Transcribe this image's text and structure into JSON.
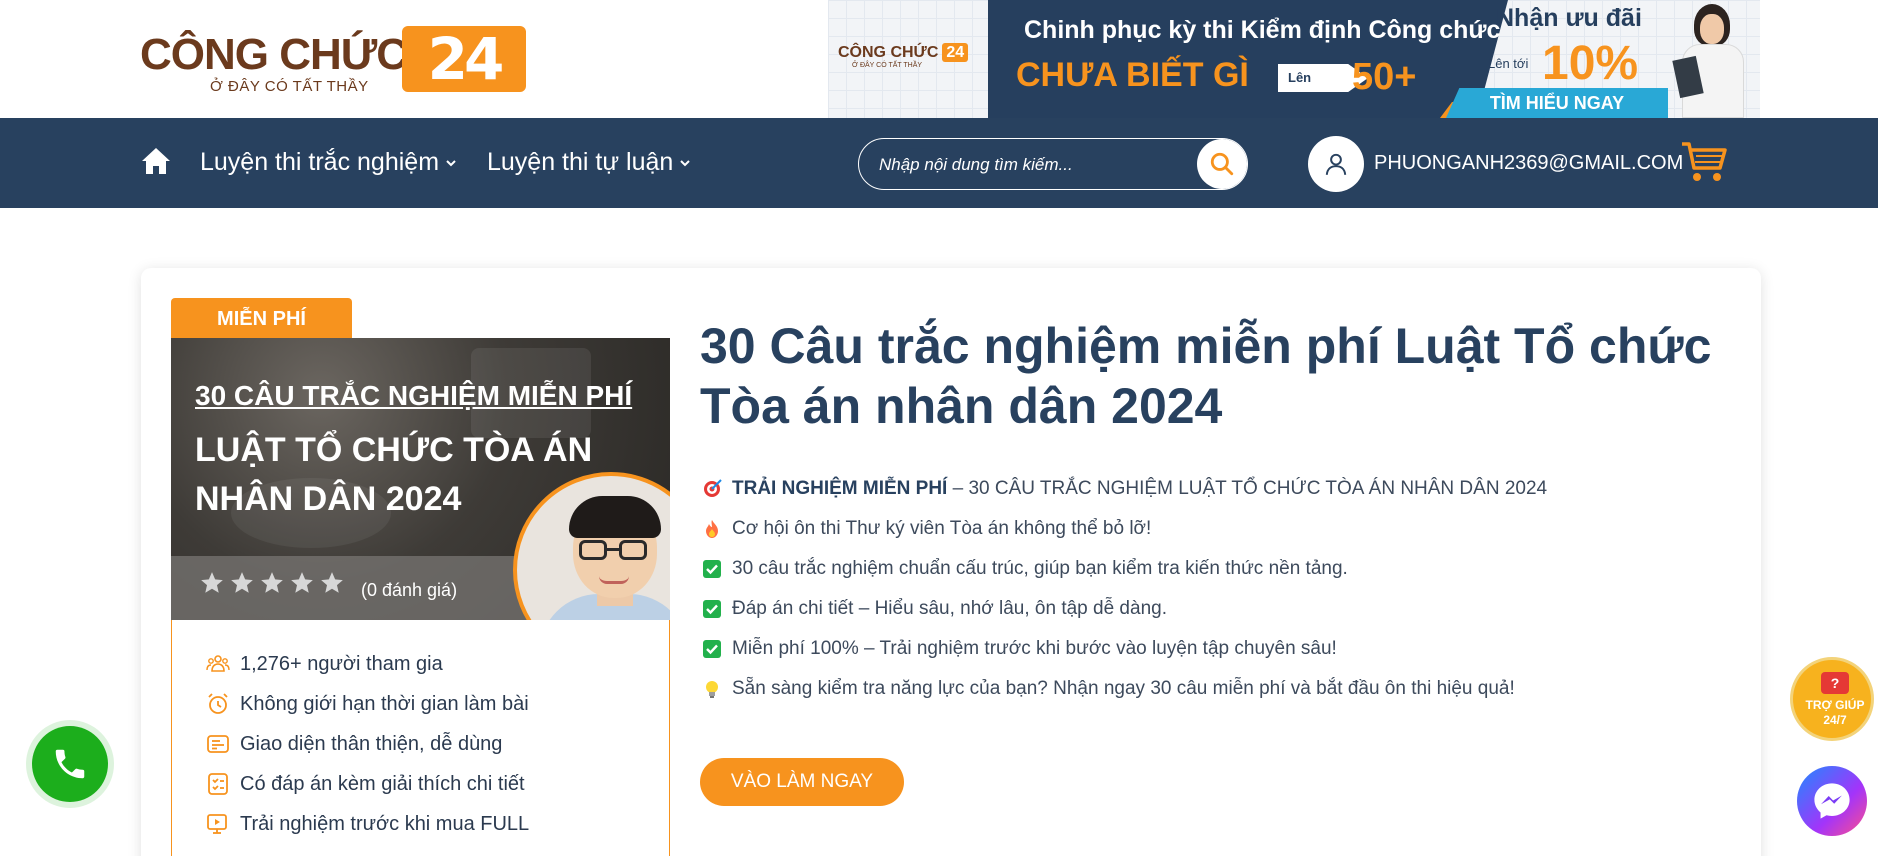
{
  "brand": {
    "name": "CÔNG CHỨC",
    "number": "24",
    "tagline": "Ở ĐÂY CÓ TẤT THẦY",
    "accent": "#f7931e",
    "navy": "#28415f"
  },
  "banner": {
    "logo_name": "CÔNG CHỨC",
    "logo_num": "24",
    "logo_tag": "Ở ĐÂY CÓ TẤT THẦY",
    "headline": "Chinh phục kỳ thi Kiểm định Công chức",
    "subline": "CHƯA BIẾT GÌ",
    "arrow_text": "Lên",
    "target": "50+",
    "offer_title": "Nhận ưu đãi",
    "offer_prefix": "Lên tới",
    "offer_value": "10%",
    "cta": "TÌM HIỂU NGAY"
  },
  "nav": {
    "home_icon": "home-icon",
    "items": [
      {
        "label": "Luyện thi trắc nghiệm"
      },
      {
        "label": "Luyện thi tự luận"
      }
    ],
    "search_placeholder": "Nhập nội dung tìm kiếm...",
    "user_email": "PHUONGANH2369@GMAIL.COM"
  },
  "course": {
    "badge": "MIỄN PHÍ",
    "thumb_line1": "30 CÂU TRẮC NGHIỆM MIỄN PHÍ",
    "thumb_line2": "LUẬT TỔ CHỨC TÒA ÁN NHÂN DÂN 2024",
    "rating": 0,
    "rating_max": 5,
    "rating_text": "(0 đánh giá)",
    "features": [
      {
        "icon": "users-icon",
        "text": "1,276+ người tham gia"
      },
      {
        "icon": "alarm-clock-icon",
        "text": "Không giới hạn thời gian làm bài"
      },
      {
        "icon": "layout-icon",
        "text": "Giao diện thân thiện, dễ dùng"
      },
      {
        "icon": "checklist-icon",
        "text": "Có đáp án kèm giải thích chi tiết"
      },
      {
        "icon": "monitor-play-icon",
        "text": "Trải nghiệm trước khi mua FULL"
      }
    ],
    "title": "30 Câu trắc nghiệm miễn phí Luật Tổ chức Tòa án nhân dân 2024",
    "desc": [
      {
        "icon": "target-icon",
        "bold": "TRẢI NGHIỆM MIỄN PHÍ",
        "text": " – 30 CÂU TRẮC NGHIỆM LUẬT TỔ CHỨC TÒA ÁN NHÂN DÂN 2024"
      },
      {
        "icon": "fire-icon",
        "bold": "",
        "text": "Cơ hội ôn thi Thư ký viên Tòa án không thể bỏ lỡ!"
      },
      {
        "icon": "check-box-icon",
        "bold": "",
        "text": "30 câu trắc nghiệm chuẩn cấu trúc, giúp bạn kiểm tra kiến thức nền tảng."
      },
      {
        "icon": "check-box-icon",
        "bold": "",
        "text": "Đáp án chi tiết – Hiểu sâu, nhớ lâu, ôn tập dễ dàng."
      },
      {
        "icon": "check-box-icon",
        "bold": "",
        "text": "Miễn phí 100% – Trải nghiệm trước khi bước vào luyện tập chuyên sâu!"
      },
      {
        "icon": "lightbulb-icon",
        "bold": "",
        "text": "Sẵn sàng kiểm tra năng lực của bạn? Nhận ngay 30 câu miễn phí và bắt đầu ôn thi hiệu quả!"
      }
    ],
    "cta": "VÀO LÀM NGAY"
  },
  "floating": {
    "help_bubble": "?",
    "help_line1": "TRỢ GIÚP",
    "help_line2": "24/7"
  }
}
